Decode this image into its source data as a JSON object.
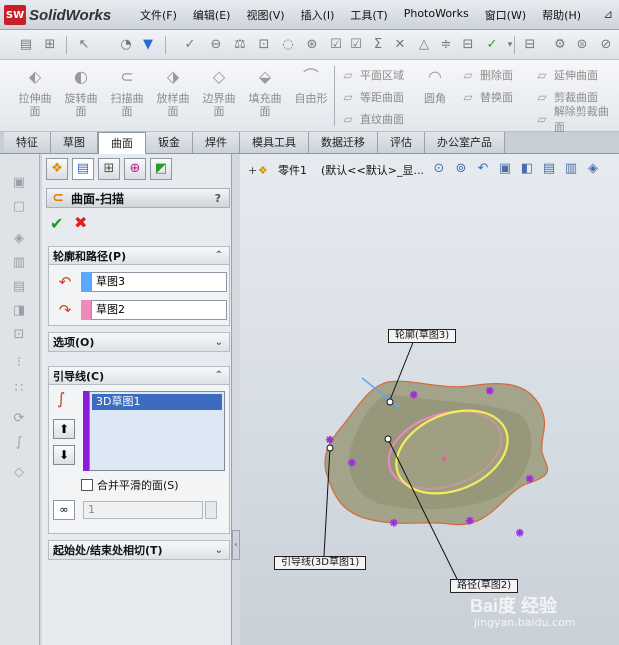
{
  "app": {
    "logo_badge": "SW",
    "name": "SolidWorks"
  },
  "menu": [
    "文件(F)",
    "编辑(E)",
    "视图(V)",
    "插入(I)",
    "工具(T)",
    "PhotoWorks",
    "窗口(W)",
    "帮助(H)"
  ],
  "command_manager": {
    "big_buttons": [
      {
        "label": "拉伸曲\n面",
        "icon": "extrude-surface-icon"
      },
      {
        "label": "旋转曲\n面",
        "icon": "revolve-surface-icon"
      },
      {
        "label": "扫描曲\n面",
        "icon": "sweep-surface-icon"
      },
      {
        "label": "放样曲\n面",
        "icon": "loft-surface-icon"
      },
      {
        "label": "边界曲\n面",
        "icon": "boundary-surface-icon"
      },
      {
        "label": "填充曲\n面",
        "icon": "fill-surface-icon"
      },
      {
        "label": "自由形",
        "icon": "freeform-icon"
      }
    ],
    "small_col1": [
      "平面区域",
      "等距曲面",
      "直纹曲面"
    ],
    "fillet_label": "圆角",
    "small_col2": [
      "删除面",
      "替换面"
    ],
    "small_col3": [
      "延伸曲面",
      "剪裁曲面",
      "解除剪裁曲面"
    ]
  },
  "tabs": [
    {
      "label": "特征",
      "active": false
    },
    {
      "label": "草图",
      "active": false
    },
    {
      "label": "曲面",
      "active": true
    },
    {
      "label": "钣金",
      "active": false
    },
    {
      "label": "焊件",
      "active": false
    },
    {
      "label": "模具工具",
      "active": false
    },
    {
      "label": "数据迁移",
      "active": false
    },
    {
      "label": "评估",
      "active": false
    },
    {
      "label": "办公室产品",
      "active": false
    }
  ],
  "property_manager": {
    "title": "曲面-扫描",
    "help": "?",
    "profile_group": {
      "title": "轮廓和路径(P)",
      "profile": "草图3",
      "path": "草图2",
      "profile_color": "#5aa8ff",
      "path_color": "#f08ab8"
    },
    "options_group": {
      "title": "选项(O)"
    },
    "guide_group": {
      "title": "引导线(C)",
      "items": [
        "3D草图1"
      ],
      "merge_smooth_label": "合并平滑的面(S)",
      "count_value": "1"
    },
    "tangency_group": {
      "title": "起始处/结束处相切(T)"
    }
  },
  "graphics": {
    "tree_part": "零件1",
    "tree_config": "(默认<<默认>_显...",
    "callouts": {
      "profile": "轮廓(草图3)",
      "guide": "引导线(3D草图1)",
      "path": "路径(草图2)"
    }
  },
  "watermark": {
    "main": "Bai度 经验",
    "sub": "jingyan.baidu.com"
  }
}
